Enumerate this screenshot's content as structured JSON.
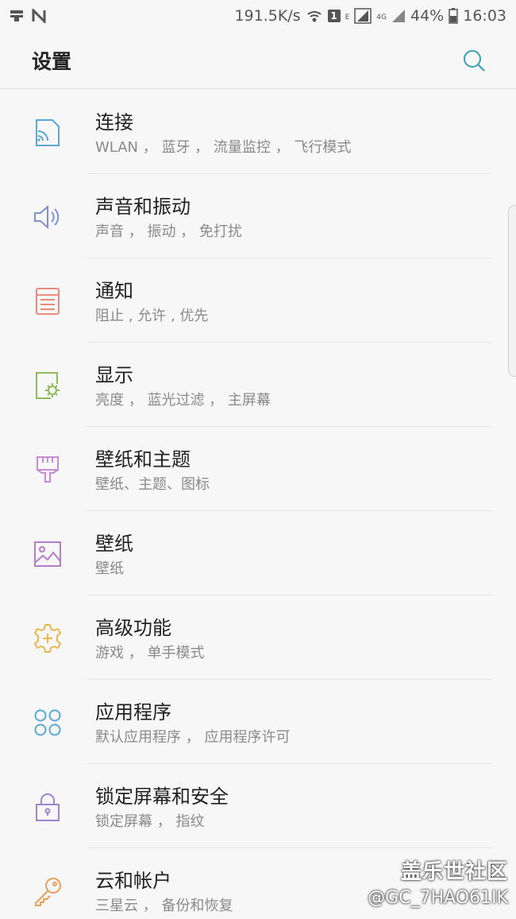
{
  "status_bar": {
    "speed": "191.5K/s",
    "notification_count": "1",
    "network_e": "E",
    "network_4g": "4G",
    "battery": "44%",
    "time": "16:03"
  },
  "header": {
    "title": "设置"
  },
  "items": [
    {
      "title": "连接",
      "subtitle": "WLAN ， 蓝牙 ， 流量监控 ， 飞行模式",
      "icon": "connection-icon",
      "color": "#5aa7d6"
    },
    {
      "title": "声音和振动",
      "subtitle": "声音 ， 振动 ， 免打扰",
      "icon": "speaker-icon",
      "color": "#7f8fd6"
    },
    {
      "title": "通知",
      "subtitle": "阻止 , 允许 , 优先",
      "icon": "notification-icon",
      "color": "#e88b7a"
    },
    {
      "title": "显示",
      "subtitle": "亮度 ， 蓝光过滤 ， 主屏幕",
      "icon": "display-icon",
      "color": "#8cbb58"
    },
    {
      "title": "壁纸和主题",
      "subtitle": "壁纸、主题、图标",
      "icon": "brush-icon",
      "color": "#c68ad6"
    },
    {
      "title": "壁纸",
      "subtitle": "壁纸",
      "icon": "image-icon",
      "color": "#b57dcb"
    },
    {
      "title": "高级功能",
      "subtitle": "游戏 ， 单手模式",
      "icon": "gear-plus-icon",
      "color": "#e8b84a"
    },
    {
      "title": "应用程序",
      "subtitle": "默认应用程序 ， 应用程序许可",
      "icon": "apps-icon",
      "color": "#5aa7d6"
    },
    {
      "title": "锁定屏幕和安全",
      "subtitle": "锁定屏幕 ， 指纹",
      "icon": "lock-icon",
      "color": "#9a86d0"
    },
    {
      "title": "云和帐户",
      "subtitle": "三星云 ， 备份和恢复",
      "icon": "key-icon",
      "color": "#e8a15a"
    }
  ],
  "watermark": {
    "brand": "盖乐世社区",
    "handle": "@GC_7HAO61IK"
  }
}
